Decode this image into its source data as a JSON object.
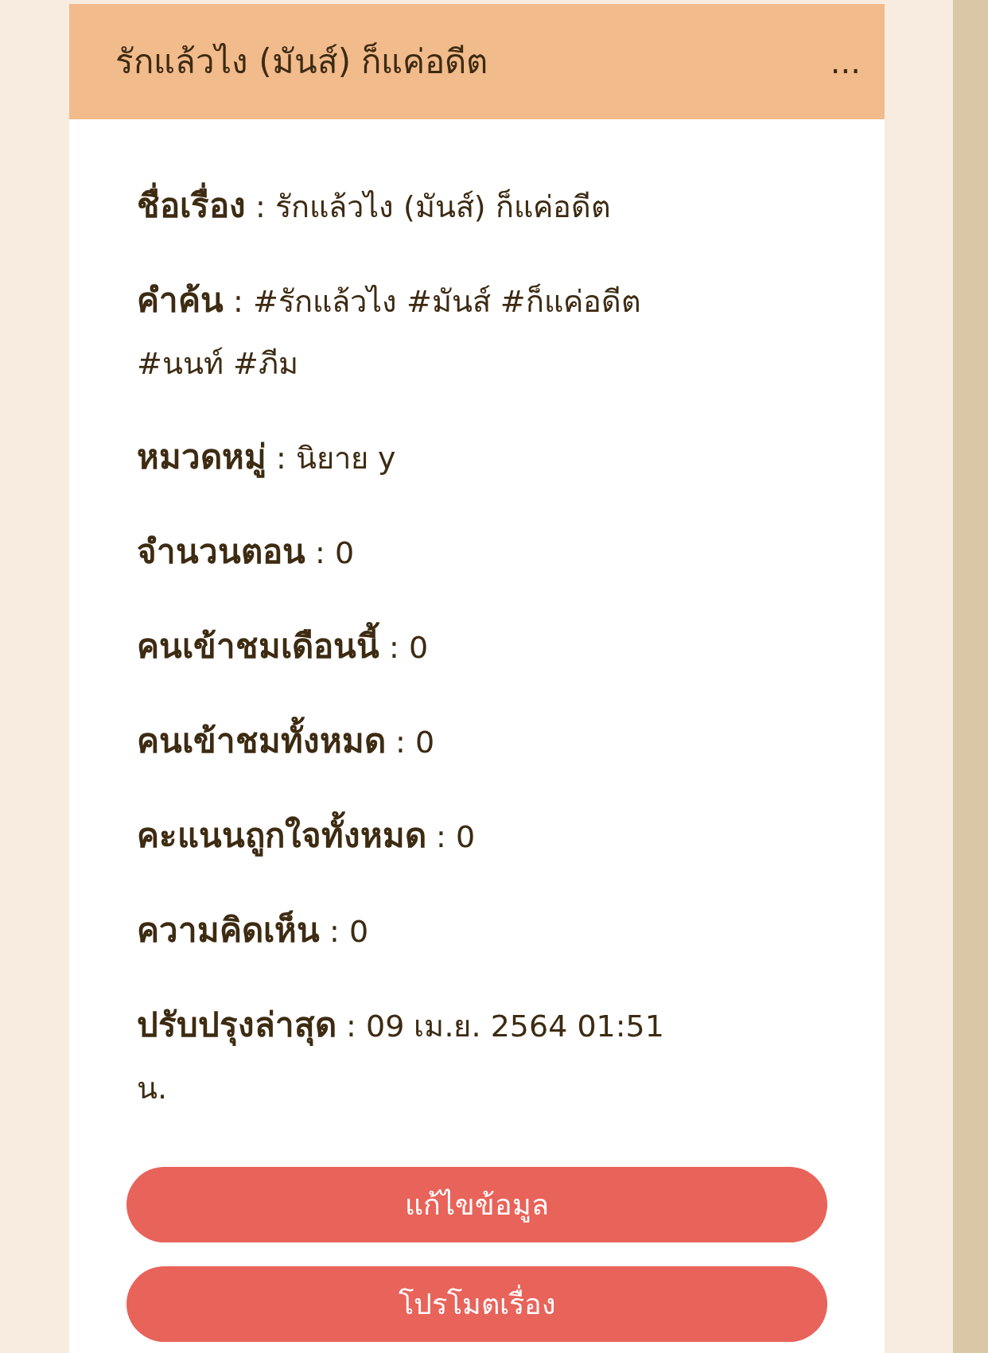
{
  "header": {
    "title": "รักแล้วไง (มันส์) ก็แค่อดีต",
    "menu": "..."
  },
  "separator": ":",
  "fields": [
    {
      "label": "ชื่อเรื่อง",
      "value": "รักแล้วไง (มันส์) ก็แค่อดีต"
    },
    {
      "label": "คำค้น",
      "value": "#รักแล้วไง #มันส์ #ก็แค่อดีต #นนท์ #ภีม"
    },
    {
      "label": "หมวดหมู่",
      "value": "นิยาย y"
    },
    {
      "label": "จำนวนตอน",
      "value": "0"
    },
    {
      "label": "คนเข้าชมเดือนนี้",
      "value": "0"
    },
    {
      "label": "คนเข้าชมทั้งหมด",
      "value": "0"
    },
    {
      "label": "คะแนนถูกใจทั้งหมด",
      "value": "0"
    },
    {
      "label": "ความคิดเห็น",
      "value": "0"
    },
    {
      "label": "ปรับปรุงล่าสุด",
      "value": "09 เม.ย. 2564 01:51 น."
    }
  ],
  "buttons": [
    "แก้ไขข้อมูล",
    "โปรโมตเรื่อง"
  ]
}
